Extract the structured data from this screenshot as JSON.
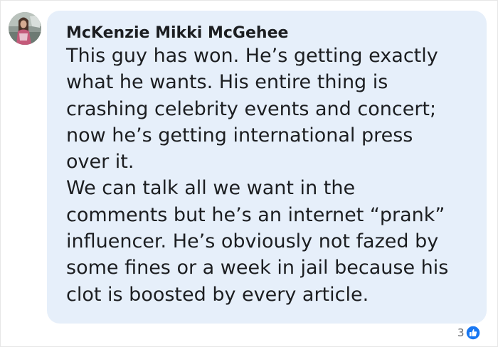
{
  "comment": {
    "author": "McKenzie Mikki McGehee",
    "paragraphs": [
      {
        "lines": [
          "This guy has won. He’s getting exactly",
          "what he wants. His entire thing is",
          "crashing celebrity events and concert;",
          "now he’s getting international press",
          "over it."
        ]
      },
      {
        "lines": [
          "We can talk all we want in the",
          "comments but he’s an internet “prank”",
          "influencer. He’s obviously not fazed by",
          "some fines or a week in jail because his",
          "clot is boosted by every article."
        ]
      }
    ],
    "reactions": {
      "count": "3",
      "icon": "like-thumbs-up-icon",
      "color": "#1877f2"
    }
  },
  "colors": {
    "bubble": "#e6effa",
    "text": "#1c1e21",
    "muted": "#65676b"
  }
}
